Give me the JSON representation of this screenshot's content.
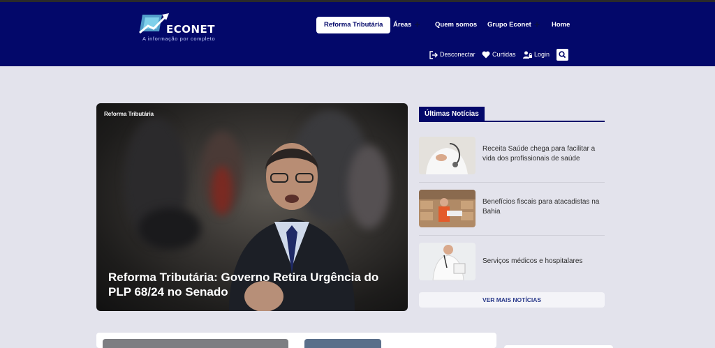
{
  "header": {
    "logo": {
      "name": "ECONET",
      "tagline": "A informação por completo"
    },
    "nav": [
      {
        "label": "Reforma Tributária",
        "active": true
      },
      {
        "label": "Áreas",
        "has_submenu": true
      },
      {
        "label": "Quem somos"
      },
      {
        "label": "Grupo Econet",
        "has_submenu": true
      },
      {
        "label": "Home"
      }
    ],
    "subnav": [
      {
        "label": "Desconectar",
        "icon": "logout-icon"
      },
      {
        "label": "Curtidas",
        "icon": "heart-icon"
      },
      {
        "label": "Login",
        "icon": "user-lock-icon"
      }
    ],
    "search_icon": "search-icon"
  },
  "hero": {
    "category": "Reforma Tributária",
    "title": "Reforma Tributária: Governo Retira Urgência do PLP 68/24 no Senado"
  },
  "latest_news": {
    "heading": "Últimas Notícias",
    "items": [
      {
        "title": "Receita Saúde chega para facilitar a vida dos profissionais de saúde"
      },
      {
        "title": "Benefícios fiscais para atacadistas na Bahia"
      },
      {
        "title": "Serviços médicos e hospitalares"
      }
    ],
    "more_label": "VER MAIS NOTÍCIAS"
  },
  "colors": {
    "header_bg": "#03086a",
    "page_bg": "#e3e3ec",
    "accent": "#03086a",
    "more_text": "#2a3a8a"
  }
}
